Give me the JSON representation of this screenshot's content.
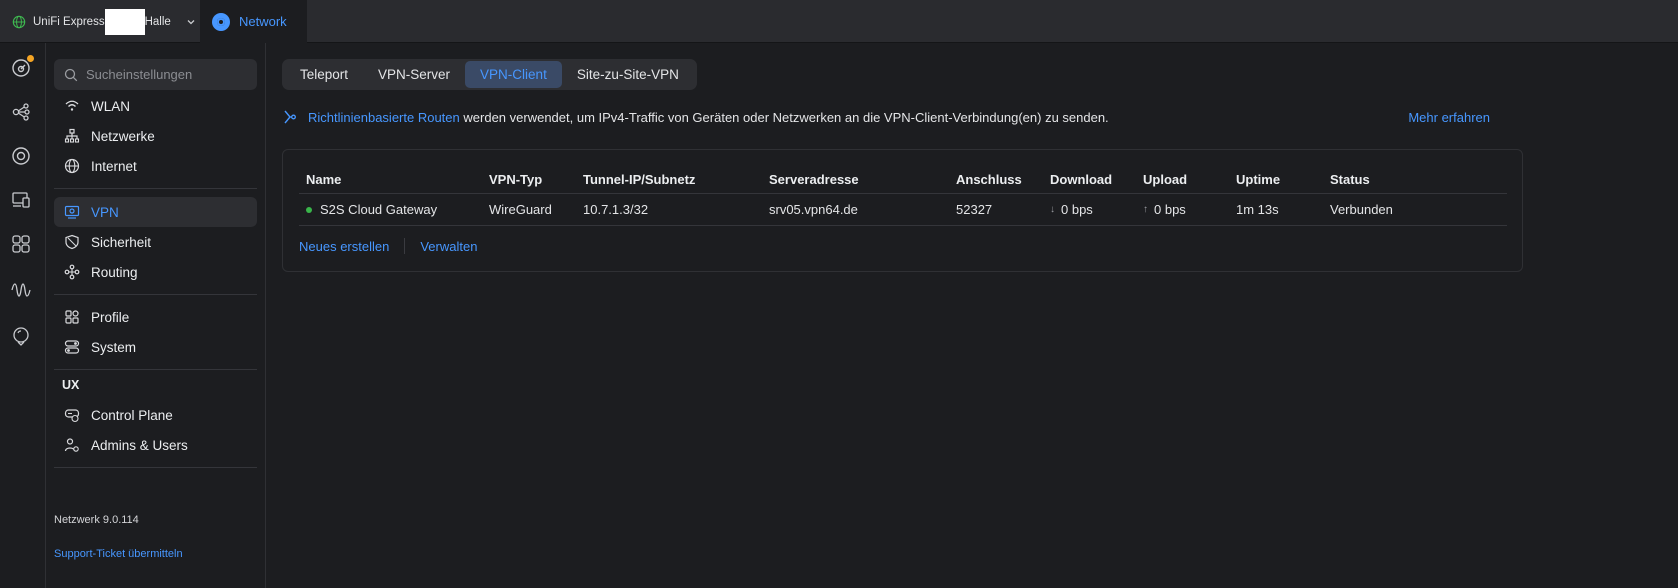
{
  "topbar": {
    "site_prefix": "UniFi Express",
    "site_suffix": "Halle",
    "app_name": "Network"
  },
  "sidebar": {
    "search_placeholder": "Sucheinstellungen",
    "items": {
      "wlan": "WLAN",
      "netzwerke": "Netzwerke",
      "internet": "Internet",
      "vpn": "VPN",
      "sicherheit": "Sicherheit",
      "routing": "Routing",
      "profile": "Profile",
      "system": "System",
      "control_plane": "Control Plane",
      "admins_users": "Admins & Users"
    },
    "section_ux": "UX",
    "version": "Netzwerk 9.0.114",
    "support": "Support-Ticket übermitteln"
  },
  "tabs": [
    "Teleport",
    "VPN-Server",
    "VPN-Client",
    "Site-zu-Site-VPN"
  ],
  "info": {
    "link": "Richtlinienbasierte Routen",
    "text": "werden verwendet, um IPv4-Traffic von Geräten oder Netzwerken an die VPN-Client-Verbindung(en) zu senden.",
    "more": "Mehr erfahren"
  },
  "table": {
    "headers": {
      "name": "Name",
      "type": "VPN-Typ",
      "tunnel": "Tunnel-IP/Subnetz",
      "server": "Serveradresse",
      "port": "Anschluss",
      "download": "Download",
      "upload": "Upload",
      "uptime": "Uptime",
      "status": "Status"
    },
    "row": {
      "name": "S2S Cloud Gateway",
      "type": "WireGuard",
      "tunnel": "10.7.1.3/32",
      "server": "srv05.vpn64.de",
      "port": "52327",
      "download": "0 bps",
      "upload": "0 bps",
      "uptime": "1m 13s",
      "status": "Verbunden"
    },
    "actions": {
      "create": "Neues erstellen",
      "manage": "Verwalten"
    }
  },
  "colors": {
    "accent": "#4797ff",
    "status_ok": "#39b54a",
    "notification": "#f5a524"
  }
}
